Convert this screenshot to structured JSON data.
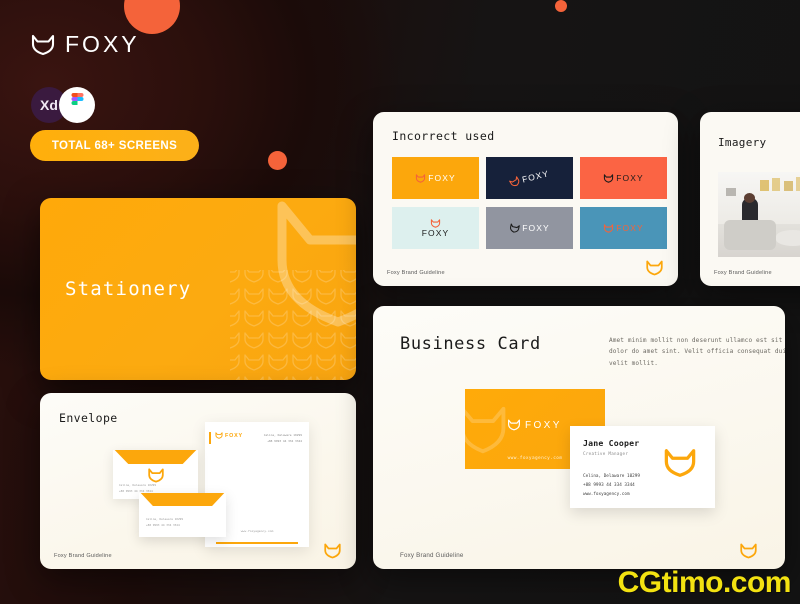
{
  "brand": {
    "wordmark": "FOXY",
    "logo_icon": "fox-head-icon",
    "accent_orange": "#FFAA0A",
    "accent_coral": "#F4633A",
    "background_dark": "#1A0D0B"
  },
  "badges": [
    {
      "name": "adobe-xd",
      "label": "Xd"
    },
    {
      "name": "figma",
      "label": "Figma"
    }
  ],
  "cta": {
    "label": "TOTAL 68+ SCREENS"
  },
  "cards": {
    "stationery": {
      "title": "Stationery"
    },
    "incorrect": {
      "title": "Incorrect used",
      "footer": "Foxy Brand Guideline",
      "swatches": [
        {
          "name": "swatch-orange",
          "bg": "#FCA70C",
          "word": "FOXY",
          "word_color": "#FFFFFF",
          "mark_color": "#F4633A",
          "variant": "inline"
        },
        {
          "name": "swatch-navy",
          "bg": "#16213A",
          "word": "FOXY",
          "word_color": "#FFFFFF",
          "mark_color": "#F4633A",
          "variant": "rotated"
        },
        {
          "name": "swatch-coral",
          "bg": "#FB6444",
          "word": "FOXY",
          "word_color": "#1B1B1B",
          "mark_color": "#1B1B1B",
          "variant": "inline"
        },
        {
          "name": "swatch-mint",
          "bg": "#DDF0EE",
          "word": "FOXY",
          "word_color": "#1B1B1B",
          "mark_color": "#F4633A",
          "variant": "stacked"
        },
        {
          "name": "swatch-gray",
          "bg": "#9195A0",
          "word": "FOXY",
          "word_color": "#FFFFFF",
          "mark_color": "#1B1B1B",
          "variant": "flipped"
        },
        {
          "name": "swatch-blue",
          "bg": "#4A95B8",
          "word": "FOXY",
          "word_color": "#F4633A",
          "mark_color": "#F4633A",
          "variant": "inline"
        }
      ]
    },
    "imagery": {
      "title": "Imagery",
      "footer": "Foxy Brand Guideline",
      "photo_alt": "office-lounge-photo"
    },
    "envelope": {
      "title": "Envelope",
      "footer": "Foxy Brand Guideline",
      "letterhead": {
        "wordmark": "FOXY",
        "address_line1": "Celina, Delaware 10299",
        "address_line2": "+88 9993 44 334 3344",
        "url": "www.foxyagency.com"
      },
      "envelope_address_line1": "Celina, Delaware 10299",
      "envelope_address_line2": "+88 9993 44 334 3344"
    },
    "business": {
      "title": "Business Card",
      "body": "Amet minim mollit non deserunt ullamco est sit aliqua dolor do amet sint. Velit officia consequat duis enim velit mollit.",
      "footer": "Foxy Brand Guideline",
      "front": {
        "wordmark": "FOXY",
        "url": "www.foxyagency.com"
      },
      "back": {
        "name": "Jane Cooper",
        "role": "Creative Manager",
        "address": "Celina, Delaware 10299",
        "phone": "+88 9993 44 334 3344",
        "url": "www.foxyagency.com"
      }
    }
  },
  "watermark": {
    "text": "CGtimo.com"
  }
}
